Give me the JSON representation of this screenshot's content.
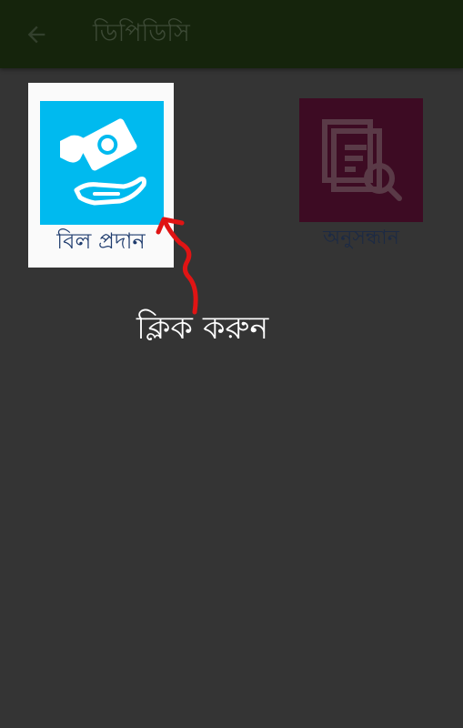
{
  "appbar": {
    "title": "ডিপিডিসি",
    "back_icon": "arrow-back-icon"
  },
  "tiles": [
    {
      "label": "বিল প্রদান",
      "icon": "hand-pay-bill-icon",
      "color": "#00baef"
    },
    {
      "label": "অনুসন্ধান",
      "icon": "document-search-icon",
      "color": "#3d0b23"
    }
  ],
  "overlay": {
    "text": "ক্লিক করুন",
    "arrow_color": "#e01414"
  }
}
